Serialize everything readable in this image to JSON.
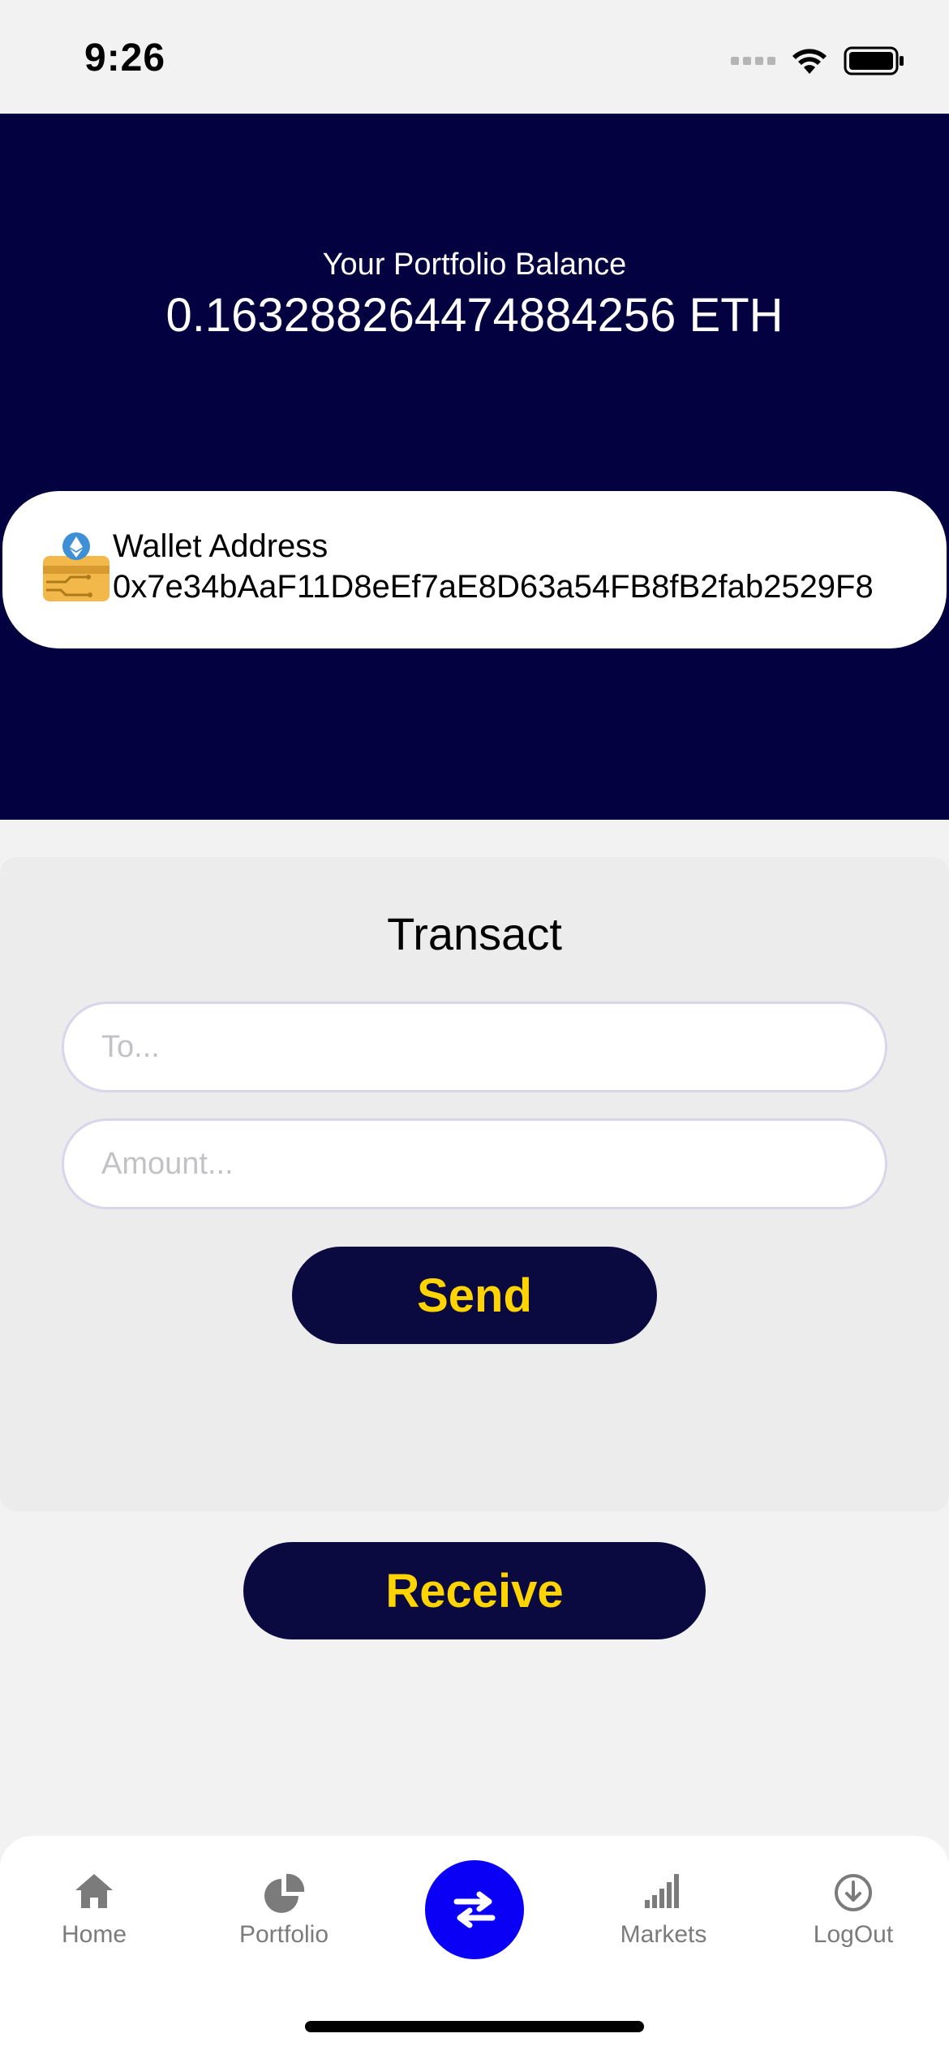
{
  "status_bar": {
    "time": "9:26"
  },
  "header": {
    "balance_label": "Your Portfolio Balance",
    "balance_value": "0.163288264474884256 ETH"
  },
  "wallet": {
    "label": "Wallet Address",
    "address": "0x7e34bAaF11D8eEf7aE8D63a54FB8fB2fab2529F8",
    "icon": "wallet-card-icon"
  },
  "transact": {
    "title": "Transact",
    "to_placeholder": "To...",
    "amount_placeholder": "Amount...",
    "send_label": "Send"
  },
  "receive_label": "Receive",
  "tab_bar": {
    "items": [
      {
        "label": "Home",
        "icon": "home-icon"
      },
      {
        "label": "Portfolio",
        "icon": "pie-chart-icon"
      },
      {
        "label": "",
        "icon": "swap-icon",
        "active": true
      },
      {
        "label": "Markets",
        "icon": "bar-chart-icon"
      },
      {
        "label": "LogOut",
        "icon": "logout-icon"
      }
    ]
  },
  "colors": {
    "header_bg": "#03013f",
    "button_bg": "#0a0a40",
    "button_text": "#ffd400",
    "fab": "#0a00f5",
    "tab_text": "#7b7b7b"
  }
}
